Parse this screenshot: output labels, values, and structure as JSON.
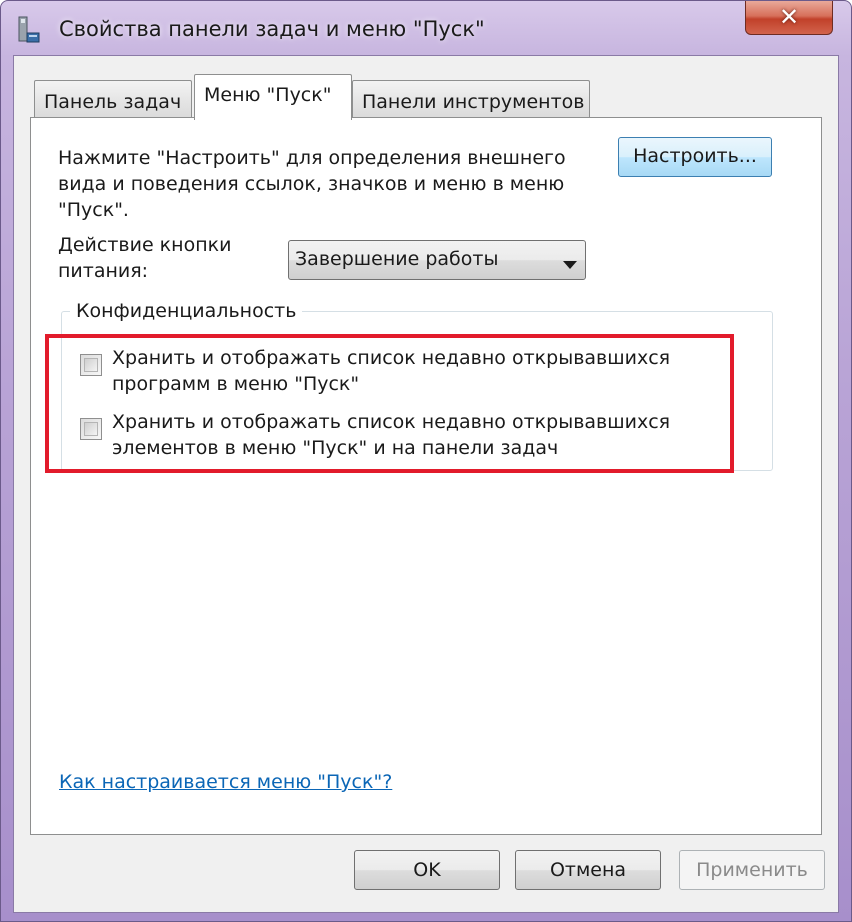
{
  "window": {
    "title": "Свойства панели задач и меню \"Пуск\"",
    "close_label": "✕"
  },
  "tabs": [
    {
      "label": "Панель задач",
      "active": false
    },
    {
      "label": "Меню \"Пуск\"",
      "active": true
    },
    {
      "label": "Панели инструментов",
      "active": false
    }
  ],
  "start_menu": {
    "description_lines": [
      "Нажмите \"Настроить\" для определения внешнего",
      "вида и поведения ссылок, значков и меню в меню",
      "\"Пуск\"."
    ],
    "customize_button": "Настроить...",
    "power_action_label_lines": [
      "Действие кнопки",
      "питания:"
    ],
    "power_action_value": "Завершение работы"
  },
  "privacy": {
    "caption": "Конфиденциальность",
    "options": [
      {
        "lines": [
          "Хранить и отображать список недавно открывавшихся",
          "программ в меню \"Пуск\""
        ],
        "checked": false
      },
      {
        "lines": [
          "Хранить и отображать список недавно открывавшихся",
          "элементов в меню \"Пуск\" и на панели задач"
        ],
        "checked": false
      }
    ]
  },
  "help_link": "Как настраивается меню \"Пуск\"?",
  "buttons": {
    "ok": "OK",
    "cancel": "Отмена",
    "apply": "Применить"
  },
  "colors": {
    "highlight_border": "#e21b2b",
    "link": "#0b66b6"
  }
}
